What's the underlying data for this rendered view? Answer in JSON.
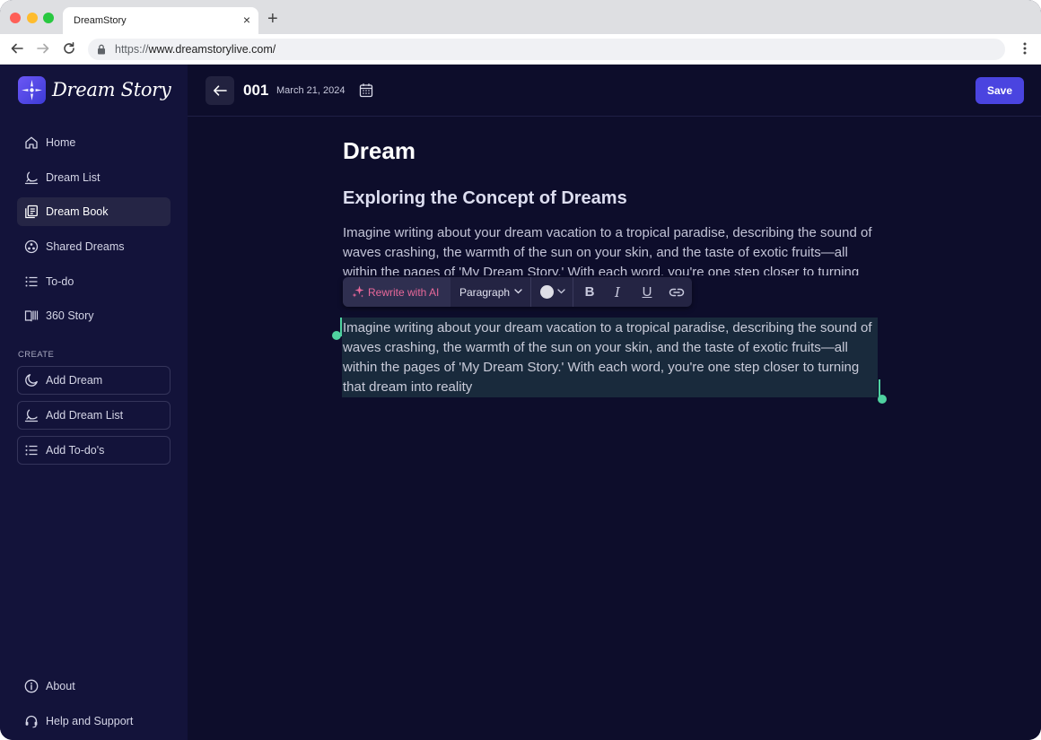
{
  "browser": {
    "tab_title": "DreamStory",
    "tab_close": "×",
    "new_tab": "+",
    "url_protocol": "https://",
    "url_host": "www.dreamstorylive.com/"
  },
  "sidebar": {
    "brand_name": "Dream Story",
    "nav": [
      {
        "label": "Home",
        "icon": "home-icon"
      },
      {
        "label": "Dream List",
        "icon": "moon-list-icon"
      },
      {
        "label": "Dream Book",
        "icon": "book-icon",
        "active": true
      },
      {
        "label": "Shared Dreams",
        "icon": "shared-icon"
      },
      {
        "label": "To-do",
        "icon": "list-icon"
      },
      {
        "label": "360 Story",
        "icon": "open-book-icon"
      }
    ],
    "create_label": "CREATE",
    "create": [
      {
        "label": "Add Dream",
        "icon": "moon-icon"
      },
      {
        "label": "Add Dream List",
        "icon": "moon-list-icon"
      },
      {
        "label": "Add To-do's",
        "icon": "list-icon"
      }
    ],
    "footer": [
      {
        "label": "About",
        "icon": "info-icon"
      },
      {
        "label": "Help and Support",
        "icon": "headset-icon"
      }
    ]
  },
  "header": {
    "doc_number": "001",
    "doc_date": "March 21, 2024",
    "save_label": "Save"
  },
  "editor": {
    "title": "Dream",
    "heading": "Exploring the Concept of Dreams",
    "paragraph_1": "Imagine writing about your dream vacation to a tropical paradise, describing the sound of waves crashing, the warmth of the sun on your skin, and the taste of exotic fruits—all within the pages of 'My Dream Story.' With each word, you're one step closer to turning that dream into reality",
    "paragraph_2": "Imagine writing about your dream vacation to a tropical paradise, describing the sound of waves crashing, the warmth of the sun on your skin, and the taste of exotic fruits—all within the pages of 'My Dream Story.' With each word, you're one step closer to turning that dream into reality"
  },
  "toolbar": {
    "rewrite_label": "Rewrite with AI",
    "paragraph_label": "Paragraph",
    "bold": "B",
    "italic": "I",
    "underline": "U"
  },
  "colors": {
    "accent": "#4a44e0",
    "ai_pink": "#e8689a",
    "selection_handle": "#4fd1a0",
    "sidebar_bg": "#13133a",
    "main_bg": "#0d0d2b"
  }
}
